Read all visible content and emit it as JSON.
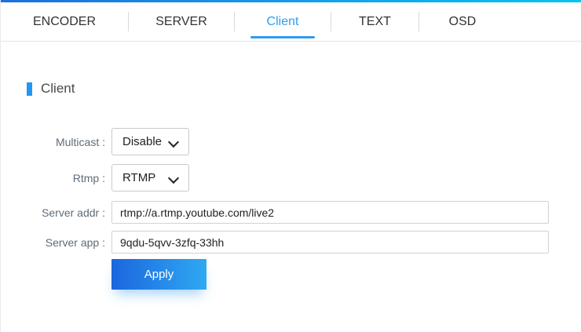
{
  "tabs": [
    {
      "label": "ENCODER",
      "active": false
    },
    {
      "label": "SERVER",
      "active": false
    },
    {
      "label": "Client",
      "active": true
    },
    {
      "label": "TEXT",
      "active": false
    },
    {
      "label": "OSD",
      "active": false
    }
  ],
  "section": {
    "title": "Client"
  },
  "form": {
    "fields": [
      {
        "label": "Multicast :",
        "control": "select",
        "value": "Disable"
      },
      {
        "label": "Rtmp :",
        "control": "select",
        "value": "RTMP"
      },
      {
        "label": "Server addr :",
        "control": "input",
        "value": "rtmp://a.rtmp.youtube.com/live2"
      },
      {
        "label": "Server app :",
        "control": "input",
        "value": "9qdu-5qvv-3zfq-33hh"
      }
    ],
    "apply_label": "Apply"
  },
  "colors": {
    "accent": "#2196f3",
    "active_tab": "#2e9cf0",
    "topbar_gradient_start": "#1c6fe0",
    "topbar_gradient_end": "#05c4ee",
    "apply_gradient_start": "#1b66de",
    "apply_gradient_end": "#2fa9f2"
  }
}
